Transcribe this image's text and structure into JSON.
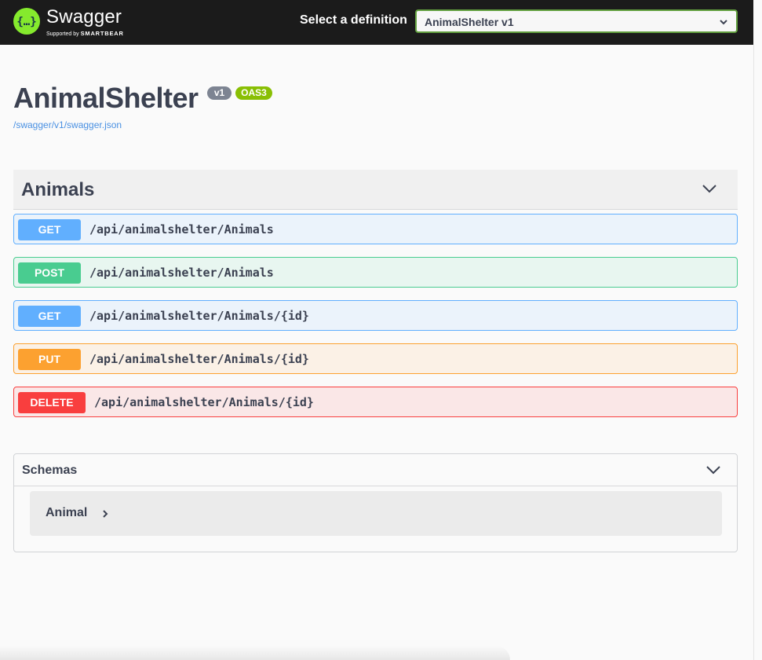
{
  "topbar": {
    "logo": {
      "name": "Swagger",
      "supported_by": "Supported by",
      "company": "SMARTBEAR",
      "icon": "swagger-logo-icon"
    },
    "definition_label": "Select a definition",
    "definition_selected": "AnimalShelter v1"
  },
  "info": {
    "title": "AnimalShelter",
    "version": "v1",
    "oas": "OAS3",
    "spec_url": "/swagger/v1/swagger.json"
  },
  "tag": {
    "name": "Animals",
    "icon": "chevron-down-icon"
  },
  "operations": [
    {
      "method": "GET",
      "path": "/api/animalshelter/Animals"
    },
    {
      "method": "POST",
      "path": "/api/animalshelter/Animals"
    },
    {
      "method": "GET",
      "path": "/api/animalshelter/Animals/{id}"
    },
    {
      "method": "PUT",
      "path": "/api/animalshelter/Animals/{id}"
    },
    {
      "method": "DELETE",
      "path": "/api/animalshelter/Animals/{id}"
    }
  ],
  "schemas": {
    "title": "Schemas",
    "models": [
      {
        "name": "Animal",
        "icon": "chevron-right-icon"
      }
    ]
  },
  "colors": {
    "topbar": "#1b1b1b",
    "get": "#61affe",
    "post": "#49cc90",
    "put": "#fca130",
    "delete": "#f93e3e",
    "brand": "#85ea2d",
    "version_badge": "#7d8492",
    "oas_badge": "#89bf04",
    "link": "#4990e2"
  }
}
